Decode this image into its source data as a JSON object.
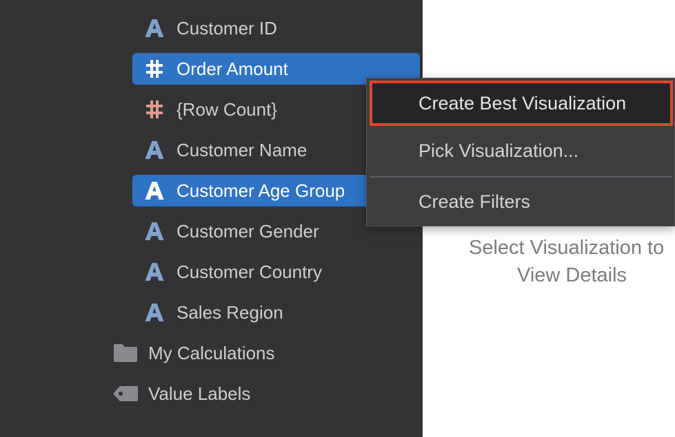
{
  "sidebar": {
    "fields": [
      {
        "label": "Customer ID",
        "icon": "text-attribute-icon",
        "selected": false
      },
      {
        "label": "Order Amount",
        "icon": "numeric-measure-icon",
        "selected": true
      },
      {
        "label": "{Row Count}",
        "icon": "numeric-measure-icon",
        "selected": false
      },
      {
        "label": "Customer Name",
        "icon": "text-attribute-icon",
        "selected": false
      },
      {
        "label": "Customer Age Group",
        "icon": "text-attribute-icon",
        "selected": true
      },
      {
        "label": "Customer Gender",
        "icon": "text-attribute-icon",
        "selected": false
      },
      {
        "label": "Customer Country",
        "icon": "text-attribute-icon",
        "selected": false
      },
      {
        "label": "Sales Region",
        "icon": "text-attribute-icon",
        "selected": false
      }
    ],
    "folders": [
      {
        "label": "My Calculations",
        "icon": "folder-icon"
      },
      {
        "label": "Value Labels",
        "icon": "tag-icon"
      }
    ]
  },
  "context_menu": {
    "items": [
      {
        "label": "Create Best Visualization",
        "highlighted": true
      },
      {
        "label": "Pick Visualization..."
      },
      {
        "label": "Create Filters"
      }
    ]
  },
  "main": {
    "hint_line1": "Select Visualization to",
    "hint_line2": "View Details"
  },
  "colors": {
    "sidebar_bg": "#333336",
    "selection": "#2f73c4",
    "attribute_icon": "#7ea3cc",
    "row_count_icon": "#e39a8c",
    "highlight_border": "#e1452a"
  }
}
